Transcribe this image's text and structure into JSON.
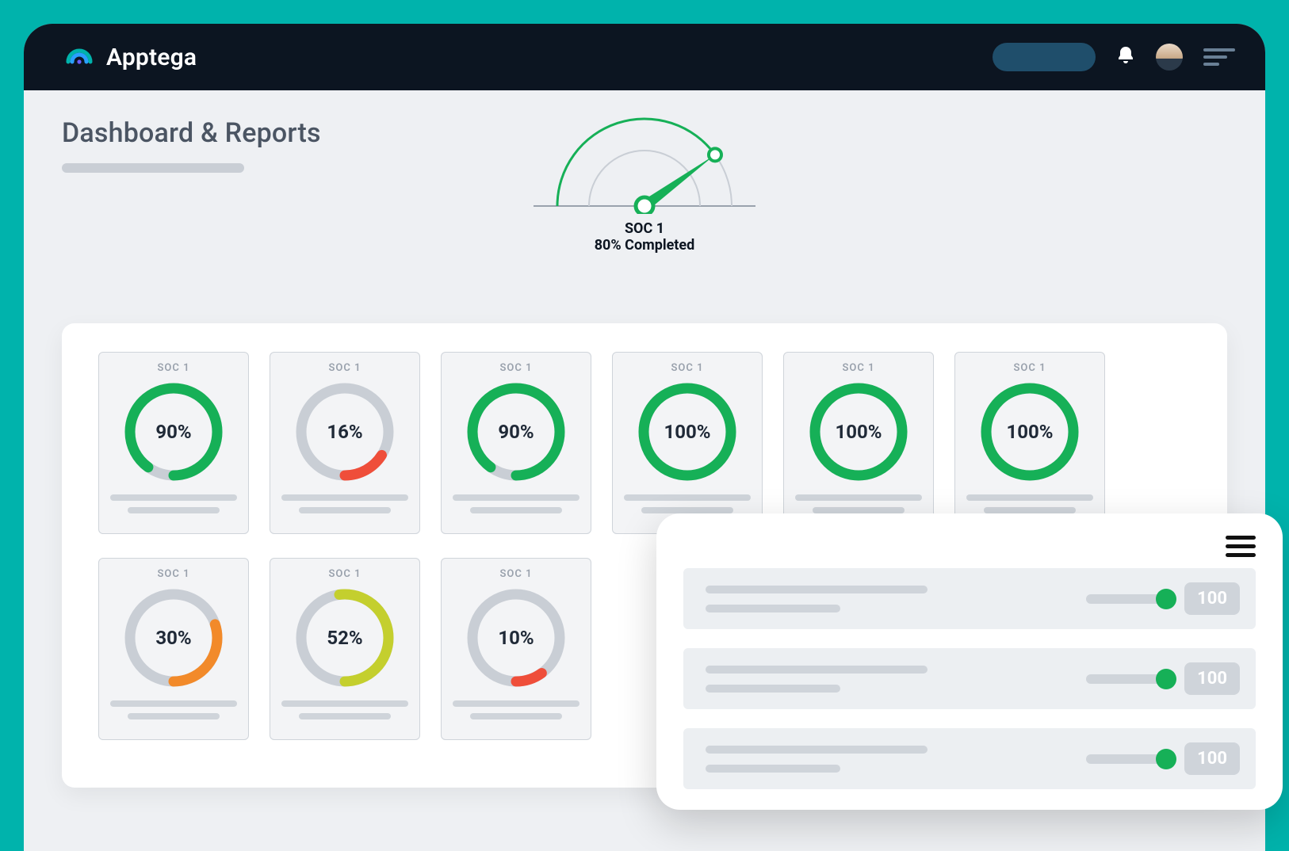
{
  "brand": {
    "name": "Apptega"
  },
  "page": {
    "title": "Dashboard & Reports"
  },
  "gauge": {
    "title": "SOC 1",
    "subtitle": "80% Completed",
    "percent": 80
  },
  "cards": [
    {
      "label": "SOC 1",
      "percent": 90,
      "color": "#16b057",
      "display": "90%"
    },
    {
      "label": "SOC 1",
      "percent": 16,
      "color": "#ef4e3a",
      "display": "16%"
    },
    {
      "label": "SOC 1",
      "percent": 90,
      "color": "#16b057",
      "display": "90%"
    },
    {
      "label": "SOC 1",
      "percent": 100,
      "color": "#16b057",
      "display": "100%"
    },
    {
      "label": "SOC 1",
      "percent": 100,
      "color": "#16b057",
      "display": "100%"
    },
    {
      "label": "SOC 1",
      "percent": 100,
      "color": "#16b057",
      "display": "100%"
    },
    {
      "label": "SOC 1",
      "percent": 30,
      "color": "#f28a2a",
      "display": "30%"
    },
    {
      "label": "SOC 1",
      "percent": 52,
      "color": "#c4cf2e",
      "display": "52%"
    },
    {
      "label": "SOC 1",
      "percent": 10,
      "color": "#ef4e3a",
      "display": "10%"
    }
  ],
  "overlay": {
    "rows": [
      {
        "score": "100"
      },
      {
        "score": "100"
      },
      {
        "score": "100"
      }
    ]
  },
  "chart_data": {
    "gauge": {
      "type": "gauge",
      "title": "SOC 1",
      "subtitle": "80% Completed",
      "value": 80,
      "range": [
        0,
        100
      ]
    },
    "donuts": {
      "type": "donut-grid",
      "label": "SOC 1",
      "items": [
        {
          "value": 90,
          "color": "#16b057"
        },
        {
          "value": 16,
          "color": "#ef4e3a"
        },
        {
          "value": 90,
          "color": "#16b057"
        },
        {
          "value": 100,
          "color": "#16b057"
        },
        {
          "value": 100,
          "color": "#16b057"
        },
        {
          "value": 100,
          "color": "#16b057"
        },
        {
          "value": 30,
          "color": "#f28a2a"
        },
        {
          "value": 52,
          "color": "#c4cf2e"
        },
        {
          "value": 10,
          "color": "#ef4e3a"
        }
      ]
    },
    "sliders": {
      "type": "progress-list",
      "items": [
        100,
        100,
        100
      ],
      "range": [
        0,
        100
      ]
    }
  }
}
